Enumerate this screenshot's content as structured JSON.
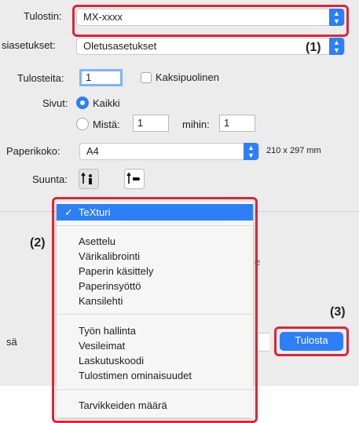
{
  "printer": {
    "label": "Tulostin:",
    "value": "MX-xxxx"
  },
  "presets": {
    "label": "siasetukset:",
    "value": "Oletusasetukset"
  },
  "copies": {
    "label": "Tulosteita:",
    "value": "1",
    "duplex_label": "Kaksipuolinen"
  },
  "pages": {
    "label": "Sivut:",
    "all_label": "Kaikki",
    "from_label": "Mistä:",
    "from_value": "1",
    "to_label": "mihin:",
    "to_value": "1"
  },
  "paper": {
    "label": "Paperikoko:",
    "value": "A4",
    "dimensions": "210 x 297 mm"
  },
  "orientation": {
    "label": "Suunta:"
  },
  "menu": {
    "selected": "TeXturi",
    "check": "✓",
    "group1": [
      "Asettelu",
      "Värikalibrointi",
      "Paperin käsittely",
      "Paperinsyöttö",
      "Kansilehti"
    ],
    "group2": [
      "Työn hallinta",
      "Vesileimat",
      "Laskutuskoodi",
      "Tulostimen ominaisuudet"
    ],
    "group3": [
      "Tarvikkeiden määrä"
    ]
  },
  "footer": {
    "left_text": "sä",
    "print_button": "Tulosta"
  },
  "callouts": {
    "c1": "(1)",
    "c2": "(2)",
    "c3": "(3)"
  },
  "colors": {
    "accent": "#2d7ff9",
    "highlight_box": "#d7283b",
    "menu_selected": "#2d7ff9"
  }
}
